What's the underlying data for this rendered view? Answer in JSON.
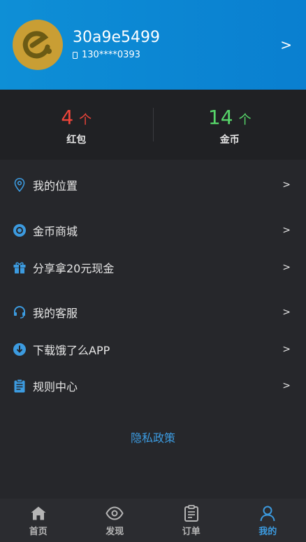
{
  "header": {
    "username": "30a9e5499",
    "phone": "130****0393",
    "chevron": ">"
  },
  "stats": [
    {
      "value": "4",
      "unit": "个",
      "label": "红包",
      "color": "#f0453a"
    },
    {
      "value": "14",
      "unit": "个",
      "label": "金币",
      "color": "#57d76a"
    }
  ],
  "menu": [
    {
      "label": "我的位置",
      "icon": "location-pin-icon",
      "chevron": ">"
    },
    {
      "label": "金币商城",
      "icon": "coin-icon",
      "chevron": ">"
    },
    {
      "label": "分享拿20元现金",
      "icon": "gift-icon",
      "chevron": ">"
    },
    {
      "label": "我的客服",
      "icon": "headset-icon",
      "chevron": ">"
    },
    {
      "label": "下载饿了么APP",
      "icon": "download-icon",
      "chevron": ">"
    },
    {
      "label": "规则中心",
      "icon": "clipboard-icon",
      "chevron": ">"
    }
  ],
  "privacy_link": "隐私政策",
  "tabs": [
    {
      "label": "首页",
      "icon": "home-icon"
    },
    {
      "label": "发现",
      "icon": "eye-icon"
    },
    {
      "label": "订单",
      "icon": "order-icon"
    },
    {
      "label": "我的",
      "icon": "user-icon",
      "active": true
    }
  ],
  "colors": {
    "accent": "#3c9be0",
    "header_bg": "#0e8fd6",
    "page_bg": "#26272b"
  }
}
